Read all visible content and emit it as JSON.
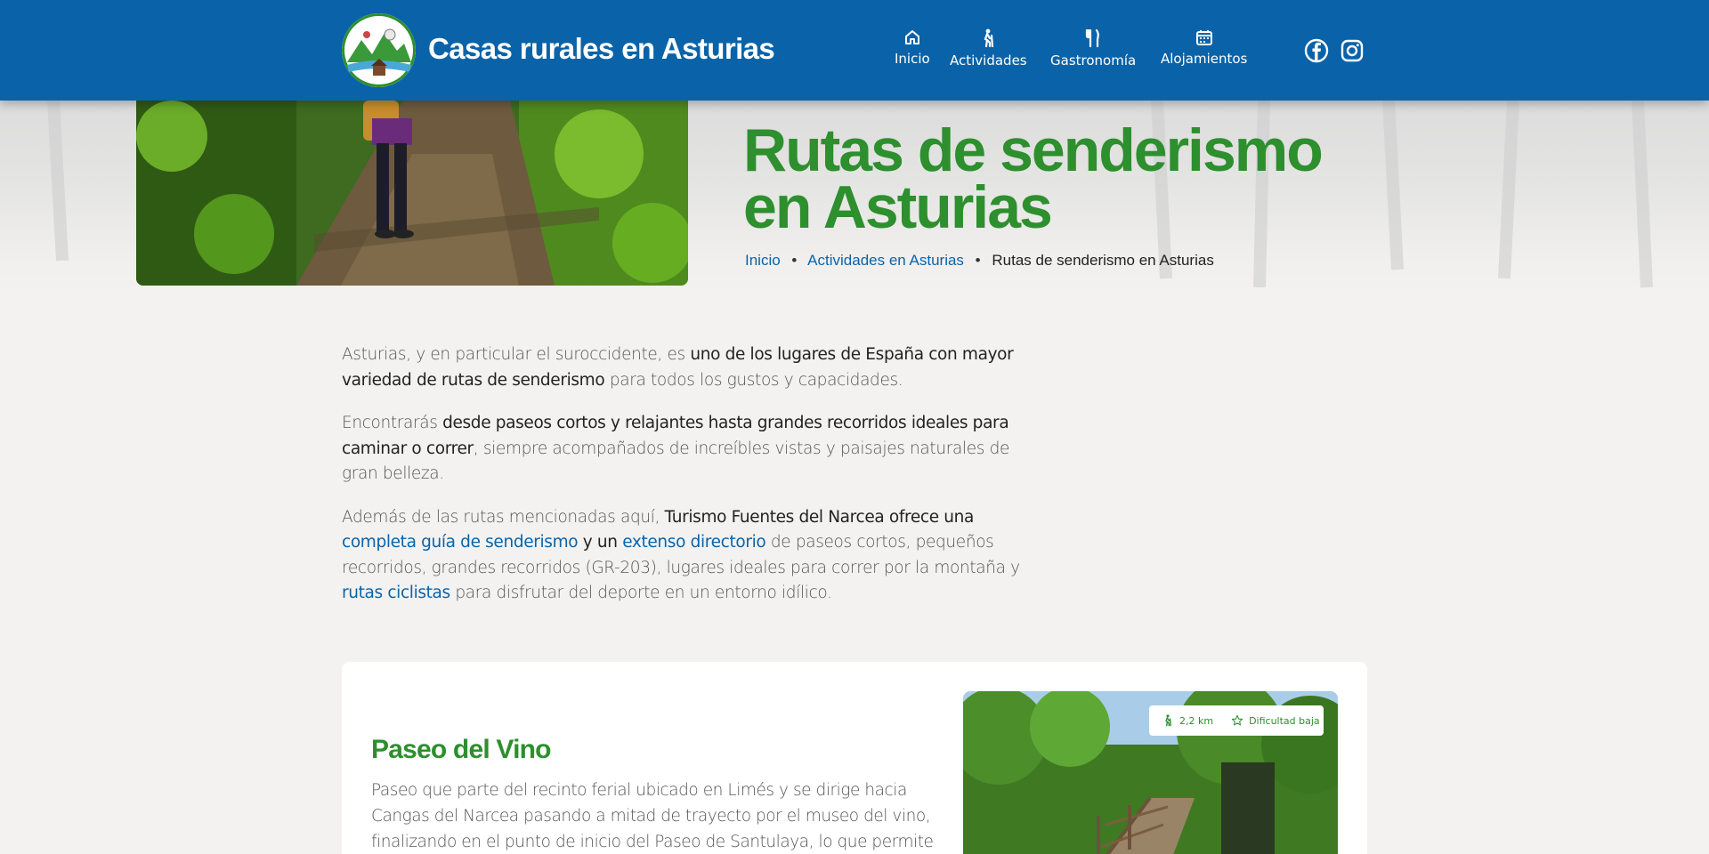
{
  "header": {
    "site_title": "Casas rurales en Asturias",
    "nav": [
      {
        "label": "Inicio",
        "icon": "home-icon"
      },
      {
        "label": "Actividades",
        "icon": "hiker-icon"
      },
      {
        "label": "Gastronomía",
        "icon": "fork-knife-icon"
      },
      {
        "label": "Alojamientos",
        "icon": "calendar-icon"
      }
    ],
    "social": [
      "facebook-icon",
      "instagram-icon"
    ],
    "color": "#0a63a8"
  },
  "hero": {
    "title_line1": "Rutas de senderismo",
    "title_line2": "en Asturias",
    "breadcrumb": {
      "home": "Inicio",
      "section": "Actividades en Asturias",
      "current": "Rutas de senderismo en Asturias"
    }
  },
  "intro": {
    "p1": {
      "t1": "Asturias, y en particular el suroccidente, es ",
      "b1": "uno de los lugares de España con mayor variedad de rutas de senderismo",
      "t2": " para todos los gustos y capacidades."
    },
    "p2": {
      "t1": "Encontrarás ",
      "b1": "desde paseos cortos y relajantes hasta grandes recorridos ideales para caminar o correr",
      "t2": ", siempre acompañados de increíbles vistas y paisajes naturales de gran belleza."
    },
    "p3": {
      "t1": "Además de las rutas mencionadas aquí, ",
      "b1": "Turismo Fuentes del Narcea ofrece una",
      "link1": "completa guía de senderismo",
      "b2": " y un ",
      "link2": "extenso directorio",
      "t2": " de paseos cortos, pequeños recorridos, grandes recorridos (GR-203), lugares ideales para correr por la montaña y ",
      "link3": "rutas ciclistas",
      "t3": " para disfrutar del deporte en un entorno idílico."
    }
  },
  "route_card": {
    "title": "Paseo del Vino",
    "description": "Paseo que parte del recinto ferial ubicado en Limés y se dirige hacia Cangas del Narcea pasando a mitad de trayecto por el museo del vino, finalizando en el punto de inicio del Paseo de Santulaya, lo que permite",
    "distance": "2,2 km",
    "difficulty": "Dificultad baja"
  },
  "colors": {
    "accent_green": "#2d8f2d",
    "link_blue": "#0a63a8",
    "background": "#f3f2f1"
  }
}
